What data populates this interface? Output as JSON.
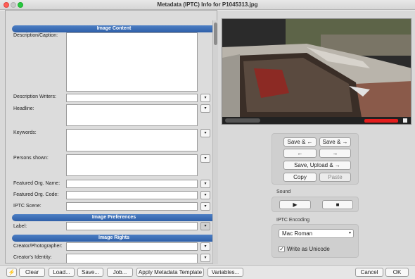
{
  "window": {
    "title": "Metadata (IPTC) Info for P1045313.jpg"
  },
  "sections": {
    "content": "Image Content",
    "preferences": "Image Preferences",
    "rights": "Image Rights"
  },
  "fields": {
    "description": "Description/Caption:",
    "description_writers": "Description Writers:",
    "headline": "Headline:",
    "keywords": "Keywords:",
    "persons_shown": "Persons shown:",
    "featured_org_name": "Featured Org. Name:",
    "featured_org_code": "Featured Org. Code:",
    "iptc_scene": "IPTC Scene:",
    "label": "Label:",
    "creator_photographer": "Creator/Photographer:",
    "creators_identity": "Creator's Identity:"
  },
  "dropdown_glyph": "▾",
  "actions": {
    "save_prev": "Save & ←",
    "save_next": "Save & →",
    "prev": "←",
    "next": "→",
    "save_upload_next": "Save, Upload & →",
    "copy": "Copy",
    "paste": "Paste"
  },
  "sound": {
    "label": "Sound",
    "play": "▶",
    "stop": "■"
  },
  "encoding": {
    "label": "IPTC Encoding",
    "selected": "Mac Roman",
    "unicode_label": "Write as Unicode",
    "unicode_checked": true,
    "check_glyph": "✓"
  },
  "bottom": {
    "bolt": "⚡",
    "clear": "Clear",
    "load": "Load...",
    "save": "Save...",
    "job": "Job...",
    "apply_template": "Apply Metadata Template",
    "variables": "Variables...",
    "cancel": "Cancel",
    "ok": "OK"
  }
}
